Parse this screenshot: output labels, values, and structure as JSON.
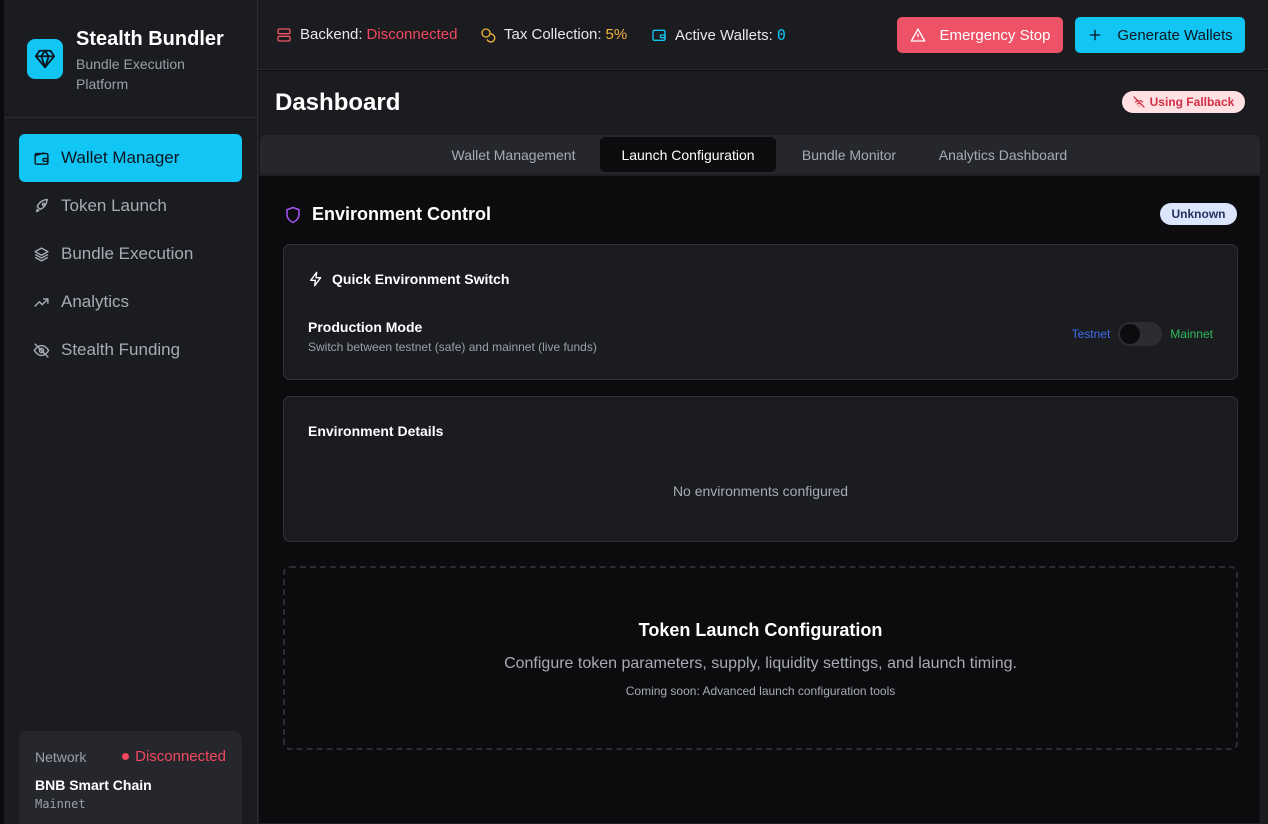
{
  "brand": {
    "title": "Stealth Bundler",
    "subtitle": "Bundle Execution Platform",
    "logo_icon": "diamond-icon"
  },
  "sidebar": {
    "items": [
      {
        "label": "Wallet Manager",
        "icon": "wallet-icon",
        "active": true
      },
      {
        "label": "Token Launch",
        "icon": "rocket-icon",
        "active": false
      },
      {
        "label": "Bundle Execution",
        "icon": "layers-icon",
        "active": false
      },
      {
        "label": "Analytics",
        "icon": "trending-up-icon",
        "active": false
      },
      {
        "label": "Stealth Funding",
        "icon": "eye-off-icon",
        "active": false
      }
    ]
  },
  "network": {
    "label": "Network",
    "status": "Disconnected",
    "chain": "BNB Smart Chain",
    "mode": "Mainnet"
  },
  "topbar": {
    "backend_label": "Backend:",
    "backend_value": "Disconnected",
    "tax_label": "Tax Collection:",
    "tax_value": "5%",
    "wallets_label": "Active Wallets:",
    "wallets_value": "0",
    "emergency_stop": "Emergency Stop",
    "generate_wallets": "Generate Wallets"
  },
  "main": {
    "title": "Dashboard",
    "fallback_badge": "Using Fallback",
    "tabs": [
      {
        "label": "Wallet Management",
        "active": false
      },
      {
        "label": "Launch Configuration",
        "active": true
      },
      {
        "label": "Bundle Monitor",
        "active": false
      },
      {
        "label": "Analytics Dashboard",
        "active": false
      }
    ]
  },
  "environment": {
    "title": "Environment Control",
    "status_badge": "Unknown",
    "quick_switch_title": "Quick Environment Switch",
    "production_label": "Production Mode",
    "production_sub": "Switch between testnet (safe) and mainnet (live funds)",
    "testnet_label": "Testnet",
    "mainnet_label": "Mainnet",
    "details_title": "Environment Details",
    "details_empty": "No environments configured"
  },
  "launch": {
    "title": "Token Launch Configuration",
    "subtitle": "Configure token parameters, supply, liquidity settings, and launch timing.",
    "note": "Coming soon: Advanced launch configuration tools"
  },
  "colors": {
    "accent": "#11c5f4",
    "danger": "#ee5266",
    "warning": "#f4b43a",
    "testnet": "#3f6df0",
    "mainnet": "#2dbb5b"
  }
}
